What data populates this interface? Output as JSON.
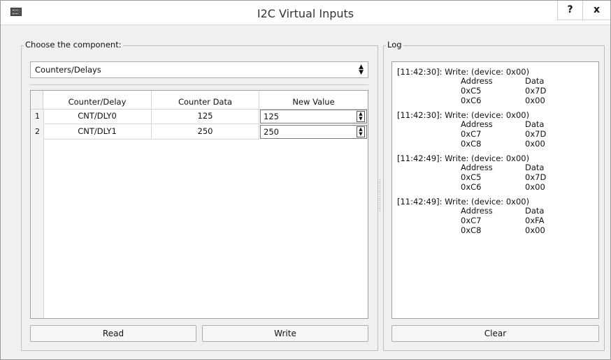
{
  "window": {
    "title": "I2C Virtual Inputs",
    "help_label": "?",
    "close_label": "x"
  },
  "left_panel": {
    "legend": "Choose the component:",
    "component_select": {
      "value": "Counters/Delays"
    },
    "table": {
      "columns": [
        "Counter/Delay",
        "Counter Data",
        "New Value"
      ],
      "rows": [
        {
          "num": "1",
          "name": "CNT/DLY0",
          "data": "125",
          "new_value": "125"
        },
        {
          "num": "2",
          "name": "CNT/DLY1",
          "data": "250",
          "new_value": "250"
        }
      ]
    },
    "read_label": "Read",
    "write_label": "Write"
  },
  "right_panel": {
    "legend": "Log",
    "entries": [
      {
        "head": "[11:42:30]: Write: (device: 0x00)",
        "header_address": "Address",
        "header_data": "Data",
        "rows": [
          {
            "address": "0xC5",
            "data": "0x7D"
          },
          {
            "address": "0xC6",
            "data": "0x00"
          }
        ]
      },
      {
        "head": "[11:42:30]: Write: (device: 0x00)",
        "header_address": "Address",
        "header_data": "Data",
        "rows": [
          {
            "address": "0xC7",
            "data": "0x7D"
          },
          {
            "address": "0xC8",
            "data": "0x00"
          }
        ]
      },
      {
        "head": "[11:42:49]: Write: (device: 0x00)",
        "header_address": "Address",
        "header_data": "Data",
        "rows": [
          {
            "address": "0xC5",
            "data": "0x7D"
          },
          {
            "address": "0xC6",
            "data": "0x00"
          }
        ]
      },
      {
        "head": "[11:42:49]: Write: (device: 0x00)",
        "header_address": "Address",
        "header_data": "Data",
        "rows": [
          {
            "address": "0xC7",
            "data": "0xFA"
          },
          {
            "address": "0xC8",
            "data": "0x00"
          }
        ]
      }
    ],
    "clear_label": "Clear"
  }
}
